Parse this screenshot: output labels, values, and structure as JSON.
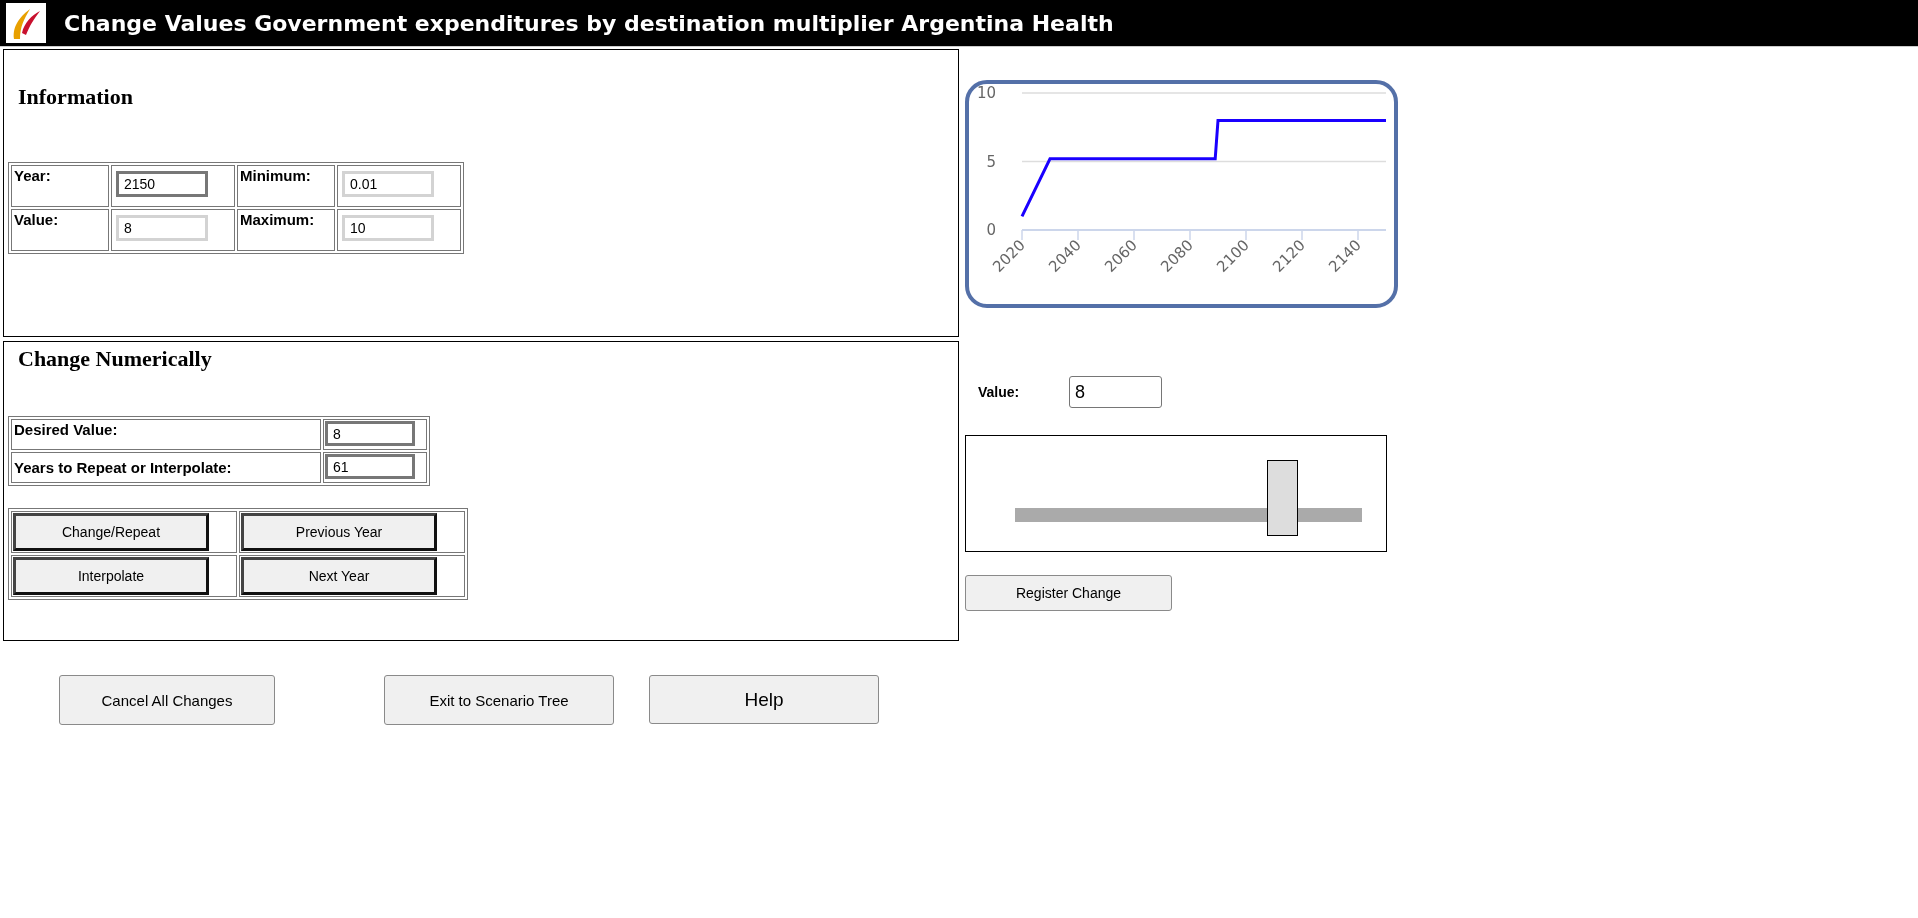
{
  "window": {
    "title": "Change Values Government expenditures by destination multiplier Argentina Health"
  },
  "information": {
    "heading": "Information",
    "fields": [
      {
        "label": "Year:",
        "value": "2150",
        "disabled": false
      },
      {
        "label": "Minimum:",
        "value": "0.01",
        "disabled": true
      },
      {
        "label": "Value:",
        "value": "8",
        "disabled": true
      },
      {
        "label": "Maximum:",
        "value": "10",
        "disabled": true
      }
    ]
  },
  "change_numerically": {
    "heading": "Change Numerically",
    "fields": [
      {
        "label": "Desired Value:",
        "value": "8"
      },
      {
        "label": "Years to Repeat or Interpolate:",
        "value": "61"
      }
    ],
    "buttons": [
      "Change/Repeat",
      "Previous Year",
      "Interpolate",
      "Next Year"
    ]
  },
  "chart": {
    "chart_data": {
      "type": "line",
      "x": [
        2020,
        2030,
        2089,
        2090,
        2150
      ],
      "series": [
        {
          "color": "#1a00ff",
          "values": [
            1,
            5.2,
            5.2,
            8,
            8
          ]
        }
      ],
      "xlim": [
        2020,
        2150
      ],
      "ylim": [
        0,
        10
      ],
      "xticks": [
        2020,
        2040,
        2060,
        2080,
        2100,
        2120,
        2140
      ],
      "yticks": [
        0,
        5,
        10
      ]
    }
  },
  "value_editor": {
    "label": "Value:",
    "value": "8",
    "slider": {
      "level": 0.77
    },
    "button": "Register Change"
  },
  "footer_buttons": [
    {
      "label": "Cancel All Changes",
      "kind": "normal"
    },
    {
      "label": "Exit to Scenario Tree",
      "kind": "normal"
    },
    {
      "label": "Help",
      "kind": "large"
    }
  ]
}
